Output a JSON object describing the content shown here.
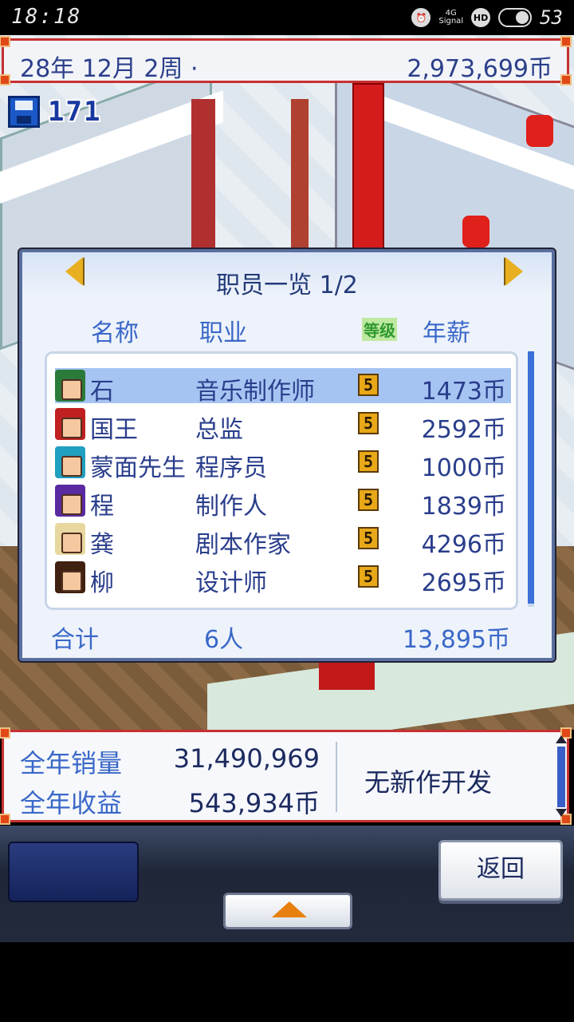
{
  "status_bar": {
    "time": "18:18",
    "network": "4G",
    "signal_label": "Signal",
    "hd": "HD",
    "battery": "53"
  },
  "header": {
    "date": "28年 12月 2周 ·",
    "funds": "2,973,699币"
  },
  "save": {
    "count": "171"
  },
  "panel": {
    "title": "职员一览 1/2",
    "columns": {
      "name": "名称",
      "job": "职业",
      "level": "等级",
      "salary": "年薪"
    },
    "rows": [
      {
        "name": "石",
        "job": "音乐制作师",
        "level": "5",
        "salary": "1473币",
        "avatar_color": "#2a7a3a"
      },
      {
        "name": "国王",
        "job": "总监",
        "level": "5",
        "salary": "2592币",
        "avatar_color": "#c02020"
      },
      {
        "name": "蒙面先生",
        "job": "程序员",
        "level": "5",
        "salary": "1000币",
        "avatar_color": "#20a0c0"
      },
      {
        "name": "程",
        "job": "制作人",
        "level": "5",
        "salary": "1839币",
        "avatar_color": "#5a2aa0"
      },
      {
        "name": "龚",
        "job": "剧本作家",
        "level": "5",
        "salary": "4296币",
        "avatar_color": "#e8d8a0"
      },
      {
        "name": "柳",
        "job": "设计师",
        "level": "5",
        "salary": "2695币",
        "avatar_color": "#402010"
      }
    ],
    "total": {
      "label": "合计",
      "count": "6人",
      "sum": "13,895币"
    }
  },
  "info": {
    "annual_sales_label": "全年销量",
    "annual_sales": "31,490,969",
    "annual_income_label": "全年收益",
    "annual_income": "543,934币",
    "status": "无新作开发"
  },
  "dock": {
    "back_label": "返回"
  },
  "colors": {
    "accent_blue": "#2a3e8c",
    "border_red": "#c83030",
    "level_gold": "#e8a818"
  }
}
